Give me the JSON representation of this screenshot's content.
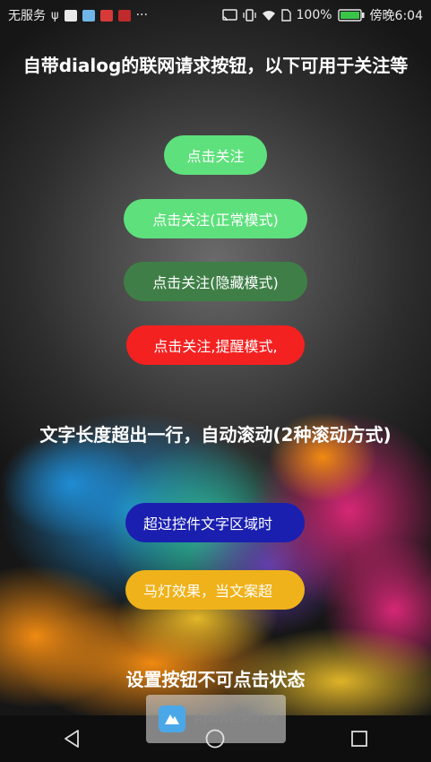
{
  "status_bar": {
    "carrier": "无服务",
    "notification_icons": [
      "usb-icon",
      "apowermirror-icon",
      "app-icon",
      "huawei-icon",
      "huawei-icon"
    ],
    "more": "···",
    "battery_percent": "100%",
    "time": "傍晚6:04"
  },
  "section1": {
    "title": "自带dialog的联网请求按钮，以下可用于关注等",
    "buttons": [
      {
        "label": "点击关注",
        "color": "#5ee07c"
      },
      {
        "label": "点击关注(正常模式)",
        "color": "#5ee07c"
      },
      {
        "label": "点击关注(隐藏模式)",
        "color": "#3f7f47"
      },
      {
        "label": "点击关注,提醒模式,",
        "color": "#f42121"
      }
    ]
  },
  "section2": {
    "title": "文字长度超出一行，自动滚动(2种滚动方式)",
    "buttons": [
      {
        "label": "超过控件文字区域时",
        "color": "#1a1fb0"
      },
      {
        "label": "马灯效果，当文案超",
        "color": "#f0b21a"
      }
    ]
  },
  "section3": {
    "title": "设置按钮不可点击状态"
  },
  "watermark": {
    "text": "ApowerMirror"
  }
}
